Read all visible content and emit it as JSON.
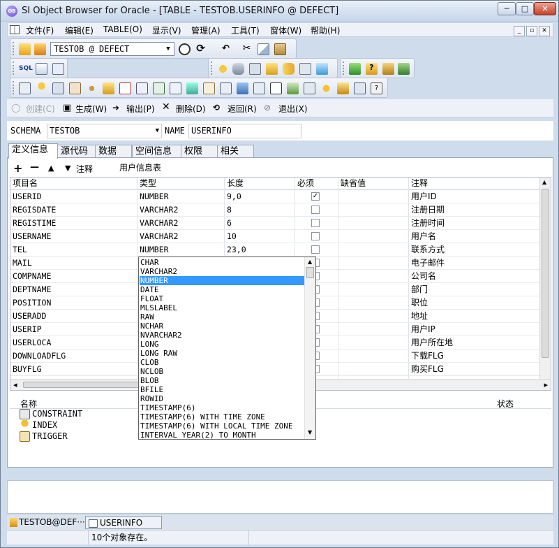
{
  "window": {
    "title": "SI Object Browser for Oracle - [TABLE - TESTOB.USERINFO @ DEFECT]",
    "app_icon_text": "OB",
    "minimize": "─",
    "maximize": "□",
    "close": "✕"
  },
  "menu": {
    "items": [
      "文件(F)",
      "编辑(E)",
      "TABLE(O)",
      "显示(V)",
      "管理(A)",
      "工具(T)",
      "窗体(W)",
      "帮助(H)"
    ],
    "mdi_min": "_",
    "mdi_restore": "▫",
    "mdi_close": "✕"
  },
  "toolbar": {
    "connection": "TESTOB @ DEFECT",
    "combo_arrow": "▼"
  },
  "commands": {
    "create": "创建(C)",
    "generate": "生成(W)",
    "output": "输出(P)",
    "delete": "删除(D)",
    "back": "返回(R)",
    "exit": "退出(X)"
  },
  "schema": {
    "schema_label": "SCHEMA",
    "schema_value": "TESTOB",
    "name_label": "NAME",
    "name_value": "USERINFO"
  },
  "tabs": [
    "定义信息",
    "源代码",
    "数据",
    "空间信息",
    "权限",
    "相关"
  ],
  "editor": {
    "add": "+",
    "remove": "—",
    "up": "▲",
    "down": "▼",
    "comment_label": "注释",
    "comment_value": "用户信息表"
  },
  "grid": {
    "headers": [
      "项目名",
      "类型",
      "长度",
      "必须",
      "缺省值",
      "注释"
    ],
    "rows": [
      {
        "name": "USERID",
        "type": "NUMBER",
        "length": "9,0",
        "required": "✓",
        "comment": "用户ID"
      },
      {
        "name": "REGISDATE",
        "type": "VARCHAR2",
        "length": "8",
        "required": "",
        "comment": "注册日期"
      },
      {
        "name": "REGISTIME",
        "type": "VARCHAR2",
        "length": "6",
        "required": "",
        "comment": "注册时间"
      },
      {
        "name": "USERNAME",
        "type": "VARCHAR2",
        "length": "10",
        "required": "",
        "comment": "用户名"
      },
      {
        "name": "TEL",
        "type": "NUMBER",
        "length": "23,0",
        "required": "",
        "comment": "联系方式"
      },
      {
        "name": "MAIL",
        "type": "",
        "length": "",
        "required": "",
        "comment": "电子邮件"
      },
      {
        "name": "COMPNAME",
        "type": "",
        "length": "",
        "required": "",
        "comment": "公司名"
      },
      {
        "name": "DEPTNAME",
        "type": "",
        "length": "",
        "required": "",
        "comment": "部门"
      },
      {
        "name": "POSITION",
        "type": "",
        "length": "",
        "required": "",
        "comment": "职位"
      },
      {
        "name": "USERADD",
        "type": "",
        "length": "",
        "required": "",
        "comment": "地址"
      },
      {
        "name": "USERIP",
        "type": "",
        "length": "",
        "required": "",
        "comment": "用户IP"
      },
      {
        "name": "USERLOCA",
        "type": "",
        "length": "",
        "required": "",
        "comment": "用户所在地"
      },
      {
        "name": "DOWNLOADFLG",
        "type": "",
        "length": "",
        "required": "",
        "comment": "下载FLG"
      },
      {
        "name": "BUYFLG",
        "type": "",
        "length": "",
        "required": "",
        "comment": "购买FLG"
      }
    ],
    "scroll_up": "▲",
    "scroll_down": "▼",
    "scroll_left": "◂",
    "scroll_right": "▸",
    "dd_arrow": "▼"
  },
  "type_dropdown": {
    "options": [
      "CHAR",
      "VARCHAR2",
      "NUMBER",
      "DATE",
      "FLOAT",
      "MLSLABEL",
      "RAW",
      "NCHAR",
      "NVARCHAR2",
      "LONG",
      "LONG RAW",
      "CLOB",
      "NCLOB",
      "BLOB",
      "BFILE",
      "ROWID",
      "TIMESTAMP(6)",
      "TIMESTAMP(6) WITH TIME ZONE",
      "TIMESTAMP(6) WITH LOCAL TIME ZONE",
      "INTERVAL YEAR(2) TO MONTH"
    ],
    "selected": "NUMBER",
    "scroll_up": "▲",
    "scroll_down": "▼"
  },
  "lower": {
    "name_header": "名称",
    "status_header": "状态",
    "items": [
      "CONSTRAINT",
      "INDEX",
      "TRIGGER"
    ]
  },
  "taskbar": {
    "items": [
      "TESTOB@DEF···",
      "USERINFO"
    ]
  },
  "status": {
    "message": "10个对象存在。"
  }
}
